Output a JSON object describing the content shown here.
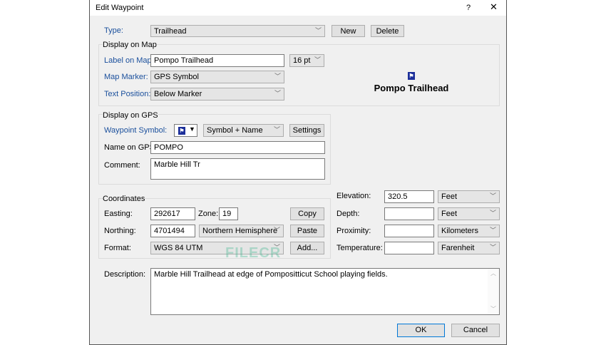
{
  "window": {
    "title": "Edit Waypoint",
    "help": "?",
    "close": "✕"
  },
  "type": {
    "label": "Type:",
    "value": "Trailhead",
    "new": "New",
    "delete": "Delete"
  },
  "map": {
    "group": "Display on Map",
    "label_on_map": "Label on Map:",
    "label_value": "Pompo Trailhead",
    "font_size": "16 pt",
    "marker_label": "Map Marker:",
    "marker_value": "GPS Symbol",
    "position_label": "Text Position:",
    "position_value": "Below Marker",
    "preview_text": "Pompo Trailhead"
  },
  "gps": {
    "group": "Display on GPS",
    "symbol_label": "Waypoint Symbol:",
    "display_mode": "Symbol + Name",
    "settings": "Settings",
    "name_label": "Name on GPS:",
    "name_value": "POMPO",
    "comment_label": "Comment:",
    "comment_value": "Marble Hill Tr"
  },
  "coords": {
    "group": "Coordinates",
    "easting_label": "Easting:",
    "easting": "292617",
    "zone_label": "Zone:",
    "zone": "19",
    "northing_label": "Northing:",
    "northing": "4701494",
    "hemisphere": "Northern Hemisphere",
    "format_label": "Format:",
    "format": "WGS 84 UTM",
    "copy": "Copy",
    "paste": "Paste",
    "add": "Add..."
  },
  "measures": [
    {
      "label": "Elevation:",
      "value": "320.5",
      "unit": "Feet"
    },
    {
      "label": "Depth:",
      "value": "",
      "unit": "Feet"
    },
    {
      "label": "Proximity:",
      "value": "",
      "unit": "Kilometers"
    },
    {
      "label": "Temperature:",
      "value": "",
      "unit": "Farenheit"
    }
  ],
  "description": {
    "label": "Description:",
    "value": "Marble Hill Trailhead at edge of Pompositticut School playing fields."
  },
  "footer": {
    "ok": "OK",
    "cancel": "Cancel"
  },
  "watermark": "FILECR"
}
